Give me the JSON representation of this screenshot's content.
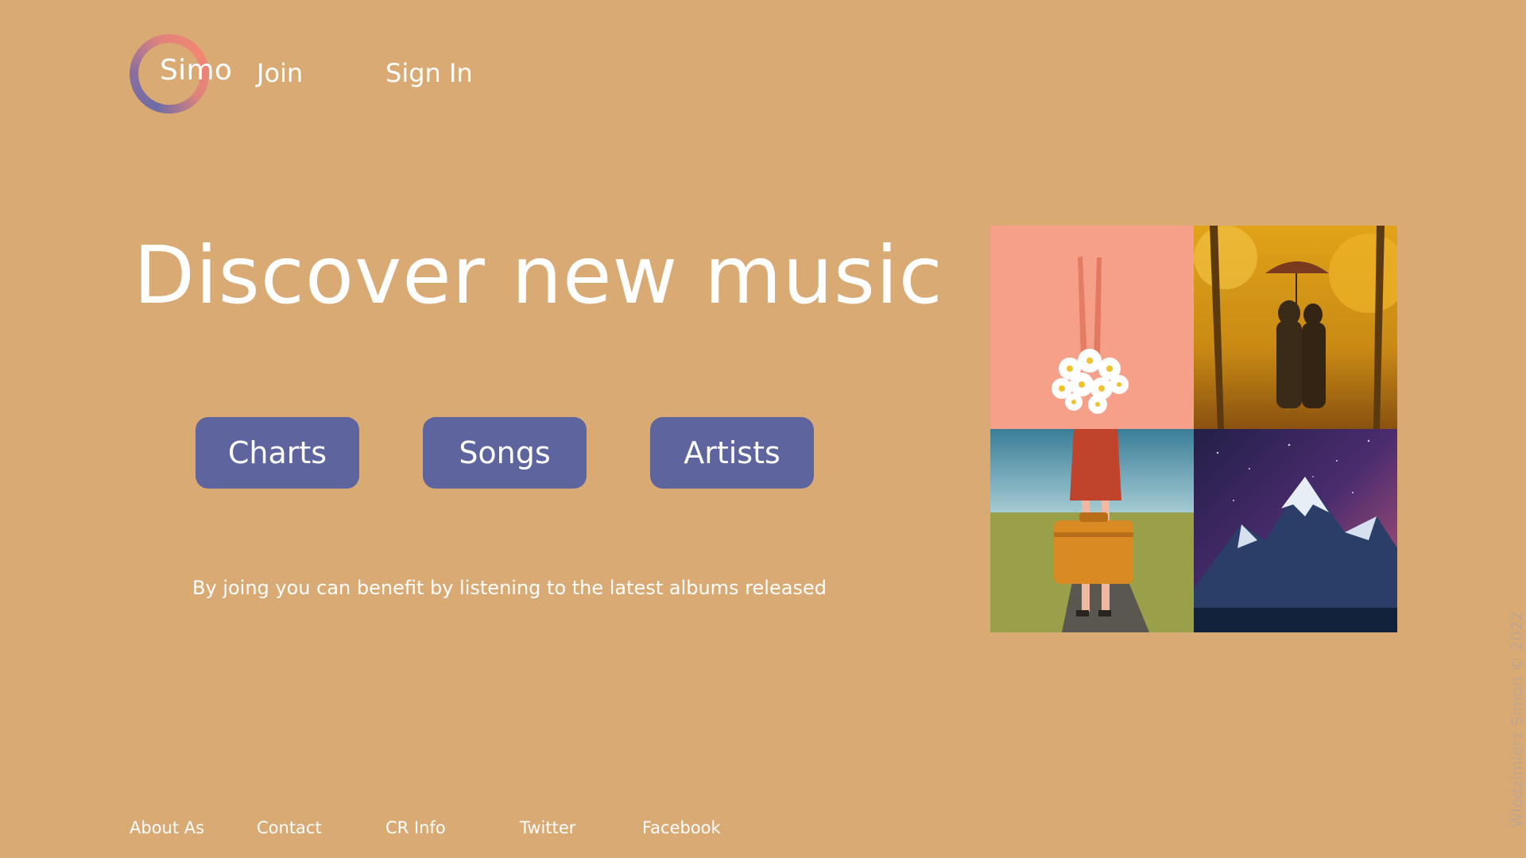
{
  "header": {
    "logo_text": "Simo",
    "nav": {
      "join": "Join",
      "sign_in": "Sign In"
    }
  },
  "hero": {
    "title": "Discover new music",
    "buttons": {
      "charts": "Charts",
      "songs": "Songs",
      "artists": "Artists"
    },
    "tagline": "By joing you can benefit by listening to the latest albums released"
  },
  "gallery": {
    "images": [
      "legs-with-daisies-image",
      "couple-with-umbrella-autumn-image",
      "woman-with-suitcase-image",
      "snowy-mountain-galaxy-image"
    ]
  },
  "footer": {
    "about": "About As",
    "contact": "Contact",
    "cr_info": "CR Info",
    "twitter": "Twitter",
    "facebook": "Facebook"
  },
  "copyright": "Wlodzimierz Simon © 2022",
  "colors": {
    "background": "#d9aa73",
    "button": "#5e649e",
    "text": "#ffffff",
    "copyright_text": "#bfa48e"
  }
}
